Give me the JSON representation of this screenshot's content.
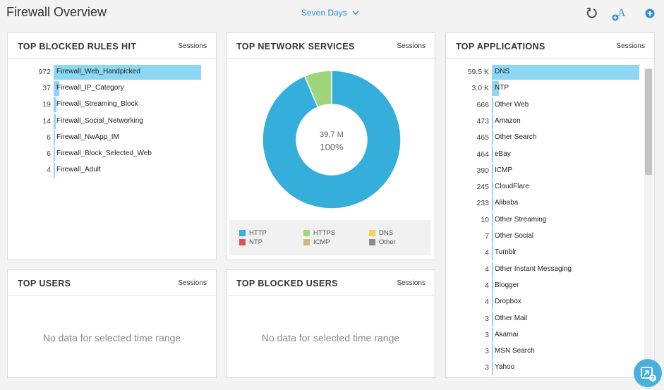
{
  "header": {
    "title": "Firewall Overview",
    "time_range": "Seven Days"
  },
  "panels": {
    "blocked_rules": {
      "title": "TOP BLOCKED RULES HIT",
      "metric": "Sessions",
      "rows": [
        {
          "value": "972",
          "label": "Firewall_Web_Handpicked",
          "fraction": 1.0
        },
        {
          "value": "37",
          "label": "Firewall_IP_Category",
          "fraction": 0.038
        },
        {
          "value": "19",
          "label": "Firewall_Streaming_Block",
          "fraction": 0.02
        },
        {
          "value": "14",
          "label": "Firewall_Social_Networking",
          "fraction": 0.014
        },
        {
          "value": "6",
          "label": "Firewall_NwApp_IM",
          "fraction": 0.006
        },
        {
          "value": "6",
          "label": "Firewall_Block_Selected_Web",
          "fraction": 0.006
        },
        {
          "value": "4",
          "label": "Firewall_Adult",
          "fraction": 0.004
        }
      ]
    },
    "network_services": {
      "title": "TOP NETWORK SERVICES",
      "metric": "Sessions",
      "center_value": "39.7 M",
      "center_percent": "100%",
      "legend": [
        {
          "label": "HTTP",
          "color": "#35aedb"
        },
        {
          "label": "HTTPS",
          "color": "#9fd67c"
        },
        {
          "label": "DNS",
          "color": "#f7cf54"
        },
        {
          "label": "NTP",
          "color": "#d9534f"
        },
        {
          "label": "ICMP",
          "color": "#c6bd7e"
        },
        {
          "label": "Other",
          "color": "#8c8c8c"
        }
      ]
    },
    "applications": {
      "title": "TOP APPLICATIONS",
      "metric": "Sessions",
      "rows": [
        {
          "value": "59.5 K",
          "label": "DNS",
          "fraction": 1.0
        },
        {
          "value": "3.0 K",
          "label": "NTP",
          "fraction": 0.05
        },
        {
          "value": "666",
          "label": "Other Web",
          "fraction": 0.011
        },
        {
          "value": "473",
          "label": "Amazon",
          "fraction": 0.008
        },
        {
          "value": "465",
          "label": "Other Search",
          "fraction": 0.008
        },
        {
          "value": "464",
          "label": "eBay",
          "fraction": 0.008
        },
        {
          "value": "390",
          "label": "ICMP",
          "fraction": 0.007
        },
        {
          "value": "245",
          "label": "CloudFlare",
          "fraction": 0.004
        },
        {
          "value": "233",
          "label": "Alibaba",
          "fraction": 0.004
        },
        {
          "value": "10",
          "label": "Other Streaming",
          "fraction": 0.0
        },
        {
          "value": "7",
          "label": "Other Social",
          "fraction": 0.0
        },
        {
          "value": "4",
          "label": "Tumblr",
          "fraction": 0.0
        },
        {
          "value": "4",
          "label": "Other Instant Messaging",
          "fraction": 0.0
        },
        {
          "value": "4",
          "label": "Blogger",
          "fraction": 0.0
        },
        {
          "value": "4",
          "label": "Dropbox",
          "fraction": 0.0
        },
        {
          "value": "3",
          "label": "Other Mail",
          "fraction": 0.0
        },
        {
          "value": "3",
          "label": "Akamai",
          "fraction": 0.0
        },
        {
          "value": "3",
          "label": "MSN Search",
          "fraction": 0.0
        },
        {
          "value": "3",
          "label": "Yahoo",
          "fraction": 0.0
        }
      ]
    },
    "users": {
      "title": "TOP USERS",
      "metric": "Sessions",
      "empty_text": "No data for selected time range"
    },
    "blocked_users": {
      "title": "TOP BLOCKED USERS",
      "metric": "Sessions",
      "empty_text": "No data for selected time range"
    }
  },
  "chart_data": {
    "type": "pie",
    "categories": [
      "HTTP",
      "HTTPS"
    ],
    "values": [
      93.6,
      6.4
    ]
  },
  "icons": [
    "chevron-down-icon",
    "refresh-icon",
    "font-add-icon",
    "add-circle-icon",
    "expand-help-icon"
  ]
}
